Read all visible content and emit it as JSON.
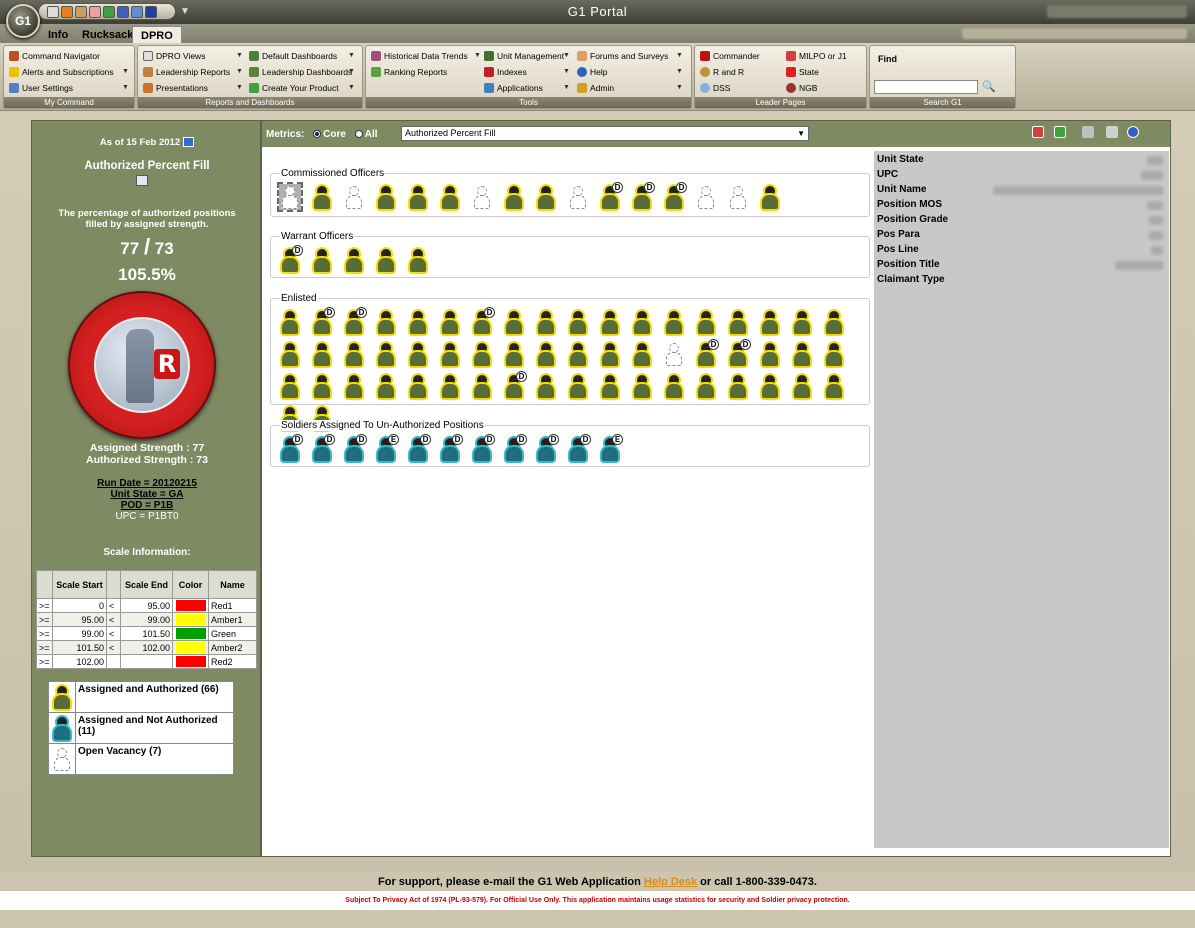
{
  "app": {
    "title": "G1 Portal",
    "logo_text": "G1"
  },
  "tabs": [
    "Info",
    "Rucksack",
    "DPRO"
  ],
  "ribbon": {
    "groups": [
      {
        "label": "My Command",
        "items": [
          {
            "label": "Command Navigator",
            "icon": "compass-icon",
            "dropdown": false
          },
          {
            "label": "Alerts and Subscriptions",
            "icon": "warning-icon",
            "dropdown": true
          },
          {
            "label": "User Settings",
            "icon": "user-icon",
            "dropdown": true
          }
        ]
      },
      {
        "label": "Reports and Dashboards",
        "items": [
          {
            "label": "DPRO Views",
            "icon": "document-icon",
            "dropdown": true
          },
          {
            "label": "Leadership Reports",
            "icon": "report-icon",
            "dropdown": true
          },
          {
            "label": "Presentations",
            "icon": "presentation-icon",
            "dropdown": true
          },
          {
            "label": "Default Dashboards",
            "icon": "dashboard-icon",
            "dropdown": true
          },
          {
            "label": "Leadership Dashboards",
            "icon": "dashboard-icon",
            "dropdown": true
          },
          {
            "label": "Create Your Product",
            "icon": "create-icon",
            "dropdown": true
          }
        ]
      },
      {
        "label": "Tools",
        "items": [
          {
            "label": "Historical Data Trends",
            "icon": "trend-icon",
            "dropdown": true
          },
          {
            "label": "Ranking Reports",
            "icon": "ranking-icon",
            "dropdown": false
          },
          {
            "label": "Unit Management",
            "icon": "unit-icon",
            "dropdown": true
          },
          {
            "label": "Indexes",
            "icon": "index-icon",
            "dropdown": true
          },
          {
            "label": "Applications",
            "icon": "applications-icon",
            "dropdown": true
          },
          {
            "label": "Forums and Surveys",
            "icon": "forum-icon",
            "dropdown": true
          },
          {
            "label": "Help",
            "icon": "help-icon",
            "dropdown": true
          },
          {
            "label": "Admin",
            "icon": "key-icon",
            "dropdown": true
          }
        ]
      },
      {
        "label": "Leader Pages",
        "items": [
          {
            "label": "Commander",
            "icon": "flag-icon"
          },
          {
            "label": "R and R",
            "icon": "rr-icon"
          },
          {
            "label": "DSS",
            "icon": "dss-icon"
          },
          {
            "label": "MILPO or J1",
            "icon": "shield-icon"
          },
          {
            "label": "State",
            "icon": "state-icon"
          },
          {
            "label": "NGB",
            "icon": "ngb-icon"
          }
        ]
      }
    ],
    "search": {
      "label": "Find",
      "group_label": "Search G1",
      "value": ""
    }
  },
  "left_panel": {
    "as_of": "As of 15 Feb 2012",
    "metric_title": "Authorized Percent Fill",
    "description": "The percentage of authorized positions filled by assigned strength.",
    "assigned": "77",
    "separator": "/",
    "authorized": "73",
    "percent": "105.5%",
    "badge_letter": "R",
    "assigned_strength": "Assigned Strength : 77",
    "authorized_strength": "Authorized Strength : 73",
    "run_date": "Run Date = 20120215",
    "unit_state": "Unit State = GA",
    "pod": "POD = P1B",
    "upc": "UPC = P1BT0",
    "scale_title": "Scale Information:",
    "scale_headers": [
      "",
      "Scale Start",
      "",
      "Scale End",
      "Color",
      "Name"
    ],
    "scale_rows": [
      {
        "op1": ">=",
        "start": "0",
        "op2": "<",
        "end": "95.00",
        "color": "#ff0000",
        "name": "Red1"
      },
      {
        "op1": ">=",
        "start": "95.00",
        "op2": "<",
        "end": "99.00",
        "color": "#ffff00",
        "name": "Amber1"
      },
      {
        "op1": ">=",
        "start": "99.00",
        "op2": "<",
        "end": "101.50",
        "color": "#00a000",
        "name": "Green"
      },
      {
        "op1": ">=",
        "start": "101.50",
        "op2": "<",
        "end": "102.00",
        "color": "#ffff00",
        "name": "Amber2"
      },
      {
        "op1": ">=",
        "start": "102.00",
        "op2": "",
        "end": "",
        "color": "#ff0000",
        "name": "Red2"
      }
    ],
    "legend": [
      {
        "label": "Assigned and Authorized (66)",
        "kind": "assigned"
      },
      {
        "label": "Assigned and Not Authorized (11)",
        "kind": "unauth"
      },
      {
        "label": "Open Vacancy (7)",
        "kind": "vacancy"
      }
    ]
  },
  "metrics": {
    "label": "Metrics:",
    "options": [
      "Core",
      "All"
    ],
    "selected": "Core",
    "dropdown_value": "Authorized Percent Fill"
  },
  "sections": [
    {
      "title": "Commissioned Officers",
      "icons": [
        "v",
        "a",
        "v",
        "a",
        "a",
        "a",
        "v",
        "a",
        "a",
        "v",
        "d",
        "d",
        "d",
        "v",
        "v",
        "a"
      ]
    },
    {
      "title": "Warrant Officers",
      "icons": [
        "d",
        "a",
        "a",
        "a",
        "a"
      ]
    },
    {
      "title": "Enlisted",
      "icons": [
        "a",
        "d",
        "d",
        "a",
        "a",
        "a",
        "d",
        "a",
        "a",
        "a",
        "a",
        "a",
        "a",
        "a",
        "a",
        "a",
        "a",
        "a",
        "a",
        "a",
        "a",
        "a",
        "a",
        "a",
        "a",
        "a",
        "a",
        "a",
        "a",
        "a",
        "v",
        "d",
        "d",
        "a",
        "a",
        "a",
        "a",
        "a",
        "a",
        "a",
        "a",
        "a",
        "a",
        "d",
        "a",
        "a",
        "a",
        "a",
        "a",
        "a",
        "a",
        "a",
        "a",
        "a",
        "a",
        "a"
      ]
    },
    {
      "title": "Soldiers Assigned To Un-Authorized Positions",
      "icons": [
        "td",
        "td",
        "td",
        "te",
        "td",
        "td",
        "td",
        "td",
        "td",
        "td",
        "te"
      ]
    }
  ],
  "details": {
    "fields": [
      "Unit State",
      "UPC",
      "Unit Name",
      "Position MOS",
      "Position Grade",
      "Pos Para",
      "Pos Line",
      "Position Title",
      "Claimant Type"
    ]
  },
  "footer": {
    "support_prefix": "For support, please e-mail the G1 Web Application ",
    "support_link": "Help Desk",
    "support_suffix": " or call 1-800-339-0473.",
    "privacy": "Subject To Privacy Act of 1974 (PL-93-579). For Official Use Only. This application maintains usage statistics for security and Soldier privacy protection."
  }
}
